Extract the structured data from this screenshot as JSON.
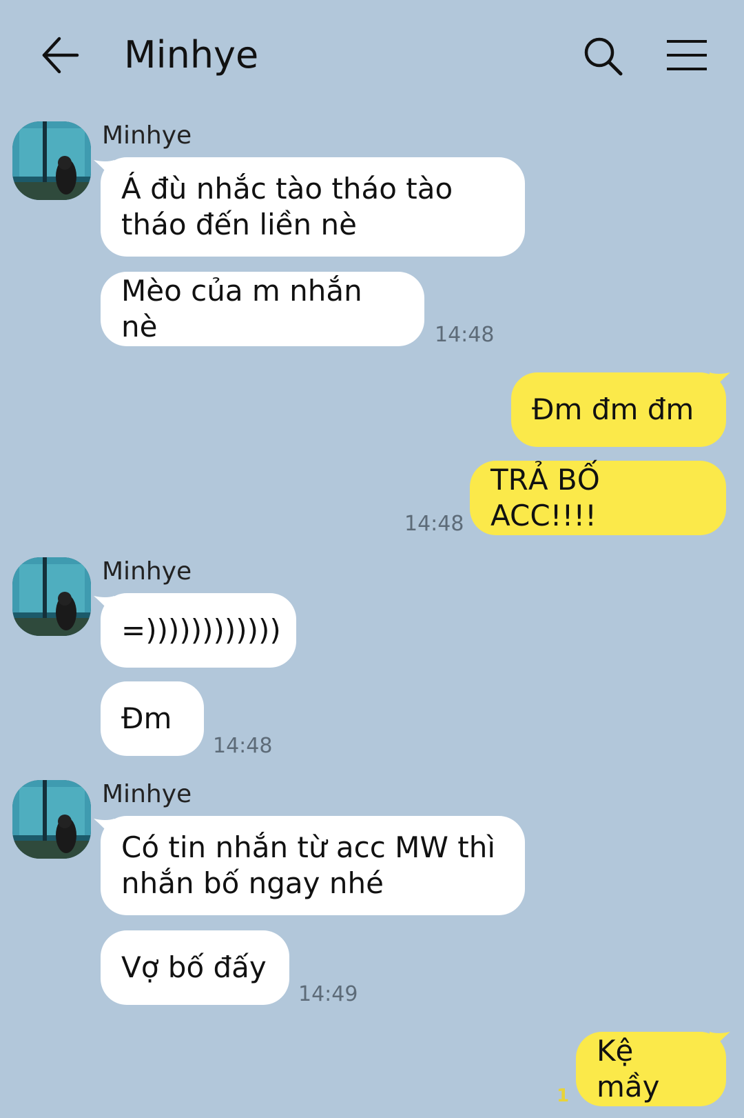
{
  "header": {
    "title": "Minhye",
    "back_icon": "arrow-left-icon",
    "search_icon": "search-icon",
    "menu_icon": "hamburger-menu-icon"
  },
  "colors": {
    "background": "#b2c7da",
    "incoming_bubble": "#ffffff",
    "outgoing_bubble": "#fbe94a",
    "unread_count": "#e8d33a"
  },
  "messages": {
    "g1": {
      "sender": "Minhye",
      "m1": "Á đù nhắc tào tháo tào\ntháo đến liền nè",
      "m2": "Mèo của m nhắn nè",
      "time": "14:48"
    },
    "g2": {
      "m1": "Đm đm đm",
      "m2": "TRẢ BỐ ACC!!!!",
      "time": "14:48"
    },
    "g3": {
      "sender": "Minhye",
      "m1": "=))))))))))))",
      "m2": "Đm",
      "time": "14:48"
    },
    "g4": {
      "sender": "Minhye",
      "m1": "Có tin nhắn từ acc MW thì\nnhắn bố ngay nhé",
      "m2": "Vợ bố đấy",
      "time": "14:49"
    },
    "g5": {
      "m1": "Kệ mầy",
      "unread": "1"
    }
  }
}
